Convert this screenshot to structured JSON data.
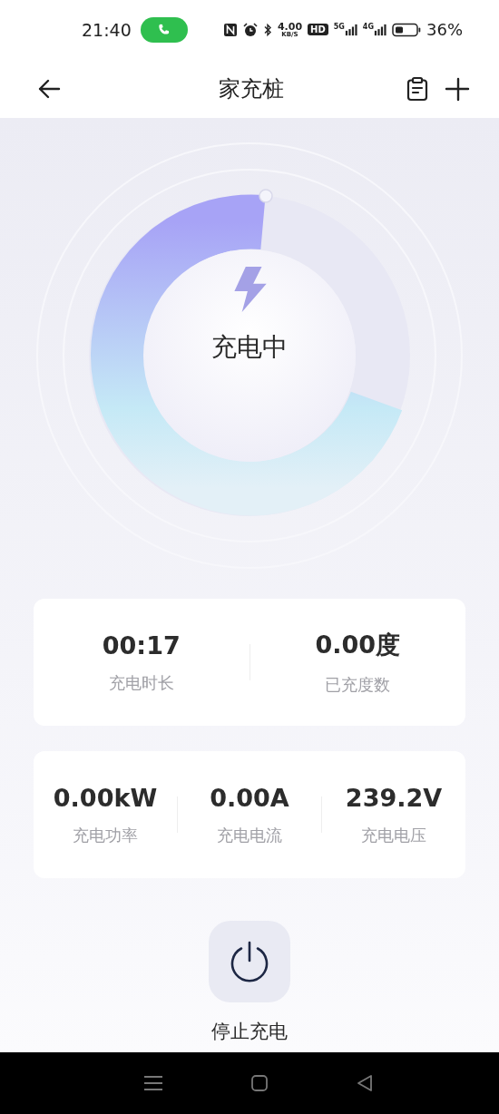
{
  "status_bar": {
    "time": "21:40",
    "net_speed": "4.00",
    "net_unit": "KB/S",
    "hd": "HD",
    "sim1": "5G",
    "sim2": "4G",
    "battery": "36%"
  },
  "header": {
    "title": "家充桩"
  },
  "charger": {
    "status": "充电中"
  },
  "summary": [
    {
      "value": "00:17",
      "label": "充电时长"
    },
    {
      "value": "0.00度",
      "label": "已充度数"
    }
  ],
  "metrics": [
    {
      "value": "0.00kW",
      "label": "充电功率"
    },
    {
      "value": "0.00A",
      "label": "充电电流"
    },
    {
      "value": "239.2V",
      "label": "充电电压"
    }
  ],
  "stop": {
    "label": "停止充电"
  }
}
